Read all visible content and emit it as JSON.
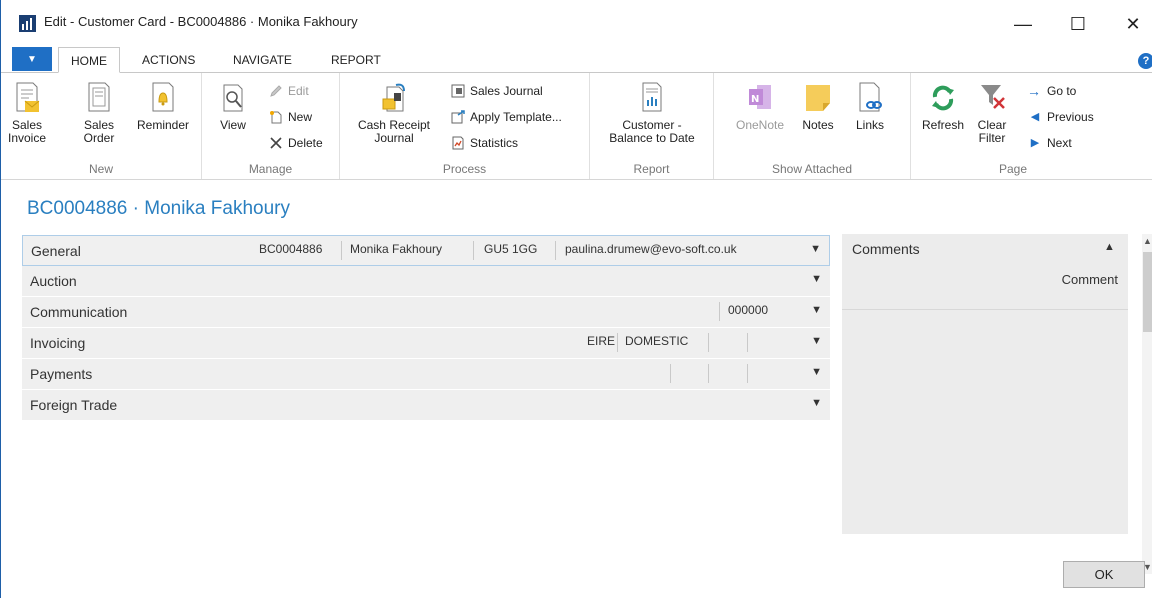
{
  "window": {
    "title": "Edit - Customer Card - BC0004886 · Monika Fakhoury",
    "minimize": "—",
    "maximize": "☐",
    "close": "✕"
  },
  "tabs": {
    "file": "▼",
    "items": [
      "HOME",
      "ACTIONS",
      "NAVIGATE",
      "REPORT"
    ],
    "active": "HOME",
    "help": "?"
  },
  "ribbon": {
    "new": {
      "label": "New",
      "sales_invoice": "Sales\nInvoice",
      "sales_order": "Sales\nOrder",
      "reminder": "Reminder"
    },
    "manage": {
      "label": "Manage",
      "view": "View",
      "edit": "Edit",
      "new": "New",
      "delete": "Delete"
    },
    "process": {
      "label": "Process",
      "cash_receipt_journal": "Cash Receipt\nJournal",
      "sales_journal": "Sales Journal",
      "apply_template": "Apply Template...",
      "statistics": "Statistics"
    },
    "report": {
      "label": "Report",
      "customer_balance": "Customer -\nBalance to Date"
    },
    "show_attached": {
      "label": "Show Attached",
      "onenote": "OneNote",
      "notes": "Notes",
      "links": "Links"
    },
    "page": {
      "label": "Page",
      "refresh": "Refresh",
      "clear_filter": "Clear\nFilter",
      "go_to": "Go to",
      "previous": "Previous",
      "next": "Next"
    }
  },
  "page_title": "BC0004886 · Monika Fakhoury",
  "fasttabs": {
    "general": {
      "label": "General",
      "no": "BC0004886",
      "name": "Monika Fakhoury",
      "postcode": "GU5 1GG",
      "email": "paulina.drumew@evo-soft.co.uk"
    },
    "auction": {
      "label": "Auction"
    },
    "communication": {
      "label": "Communication",
      "value": "000000"
    },
    "invoicing": {
      "label": "Invoicing",
      "country": "EIRE",
      "posting_group": "DOMESTIC"
    },
    "payments": {
      "label": "Payments"
    },
    "foreign_trade": {
      "label": "Foreign Trade"
    }
  },
  "factbox": {
    "title": "Comments",
    "column": "Comment"
  },
  "ok_button": "OK",
  "colors": {
    "accent": "#1f6fc5",
    "title_blue": "#2a7fc0",
    "fasttab_bg": "#efefef",
    "focus_border": "#aecde8"
  }
}
